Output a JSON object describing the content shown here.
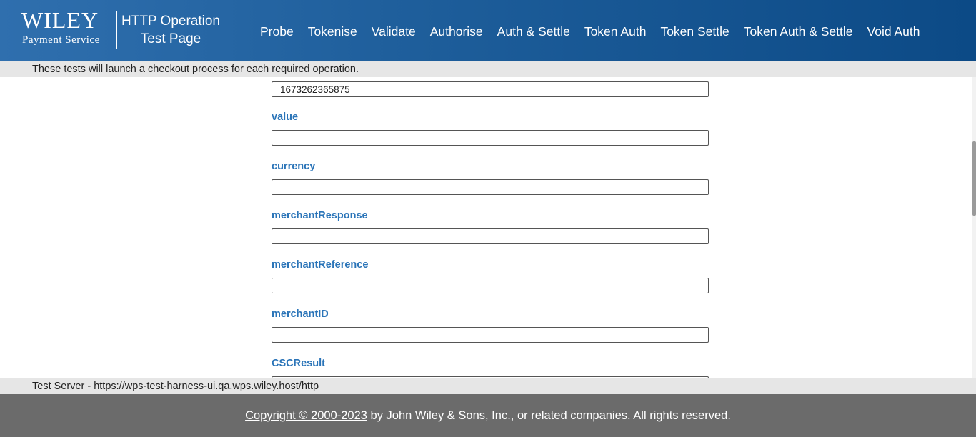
{
  "brand": {
    "wordmark": "WILEY",
    "subtitle": "Payment Service"
  },
  "header": {
    "title_line1": "HTTP Operation",
    "title_line2": "Test Page"
  },
  "nav": {
    "items": [
      {
        "label": "Probe",
        "active": false
      },
      {
        "label": "Tokenise",
        "active": false
      },
      {
        "label": "Validate",
        "active": false
      },
      {
        "label": "Authorise",
        "active": false
      },
      {
        "label": "Auth & Settle",
        "active": false
      },
      {
        "label": "Token Auth",
        "active": true
      },
      {
        "label": "Token Settle",
        "active": false
      },
      {
        "label": "Token Auth & Settle",
        "active": false
      },
      {
        "label": "Void Auth",
        "active": false
      }
    ]
  },
  "info": {
    "text": "These tests will launch a checkout process for each required operation."
  },
  "form": {
    "top_field_value": "1673262365875",
    "fields": [
      {
        "label": "value",
        "value": ""
      },
      {
        "label": "currency",
        "value": ""
      },
      {
        "label": "merchantResponse",
        "value": ""
      },
      {
        "label": "merchantReference",
        "value": ""
      },
      {
        "label": "merchantID",
        "value": ""
      },
      {
        "label": "CSCResult",
        "value": ""
      }
    ]
  },
  "server": {
    "text": "Test Server - https://wps-test-harness-ui.qa.wps.wiley.host/http"
  },
  "footer": {
    "copyright_link": "Copyright © 2000-2023",
    "rest": " by John Wiley & Sons, Inc., or related companies. All rights reserved."
  },
  "colors": {
    "header_start": "#2f6fae",
    "header_end": "#0c4a86",
    "label_blue": "#2a74b8",
    "strip_gray": "#e6e6e6",
    "footer_gray": "#6b6b6b"
  }
}
